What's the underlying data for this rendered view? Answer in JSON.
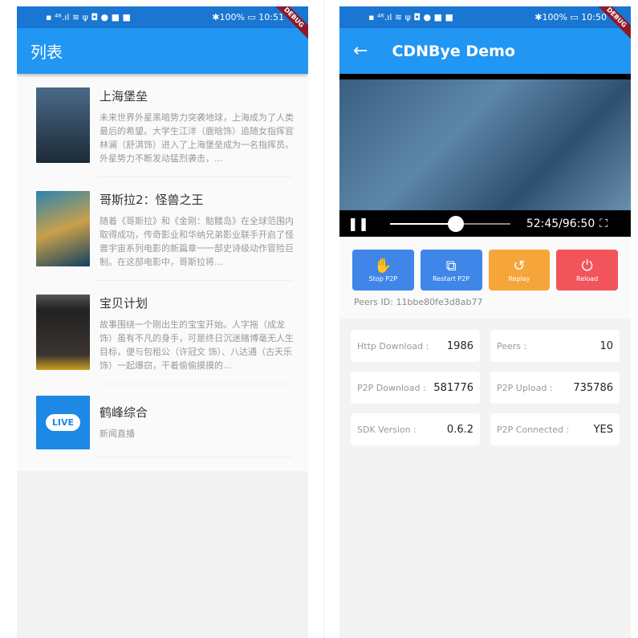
{
  "left": {
    "status": {
      "left": "▪ ⁴⁶.ıl ≋ ψ ◘ ● ■ ■",
      "right": "✱100% ▭ 10:51"
    },
    "debug": "DEBUG",
    "title": "列表",
    "items": [
      {
        "title": "上海堡垒",
        "desc": "未来世界外星黑暗势力突袭地球，上海成为了人类最后的希望。大学生江洋（鹿晗饰）追随女指挥官林澜（舒淇饰）进入了上海堡垒成为一名指挥员。外星势力不断发动猛烈袭击，...",
        "thumb_color": "#2b3a48"
      },
      {
        "title": "哥斯拉2：怪兽之王",
        "desc": "随着《哥斯拉》和《金刚：骷髅岛》在全球范围内取得成功，传奇影业和华纳兄弟影业联手开启了怪兽宇宙系列电影的新篇章一一部史诗级动作冒险巨制。在这部电影中，哥斯拉将...",
        "thumb_color": "#1f5f7f"
      },
      {
        "title": "宝贝计划",
        "desc": "故事围绕一个刚出生的宝宝开始。人字拖（成龙 饰）虽有不凡的身手，可是终日沉迷赌博毫无人生目标，便与包租公（许冠文 饰）、八达通（古天乐 饰）一起爆窃，干着偷偷摸摸的...",
        "thumb_color": "#2a2622"
      },
      {
        "title": "鹤峰综合",
        "desc": "新闻直播",
        "thumb_label": "LIVE",
        "thumb_color": "#1e88e5"
      }
    ]
  },
  "right": {
    "status": {
      "left": "▪ ⁴⁶.ıl ≋ ψ ◘ ● ■ ■",
      "right": "✱100% ▭ 10:50"
    },
    "debug": "DEBUG",
    "title": "CDNBye Demo",
    "player": {
      "time": "52:45/96:50",
      "progress": 0.545
    },
    "buttons": [
      {
        "label": "Stop P2P",
        "icon": "hand-icon",
        "color": "#3f86e8"
      },
      {
        "label": "Restart P2P",
        "icon": "cast-icon",
        "color": "#3f86e8"
      },
      {
        "label": "Replay",
        "icon": "replay-icon",
        "color": "#f6a53a"
      },
      {
        "label": "Reload",
        "icon": "power-icon",
        "color": "#f2545b"
      }
    ],
    "peers_id": "Peers ID: 11bbe80fe3d8ab77",
    "stats": [
      [
        {
          "label": "Http Download :",
          "value": "1986"
        },
        {
          "label": "Peers :",
          "value": "10"
        }
      ],
      [
        {
          "label": "P2P Download :",
          "value": "581776"
        },
        {
          "label": "P2P Upload :",
          "value": "735786"
        }
      ],
      [
        {
          "label": "SDK Version :",
          "value": "0.6.2"
        },
        {
          "label": "P2P Connected :",
          "value": "YES"
        }
      ]
    ]
  }
}
